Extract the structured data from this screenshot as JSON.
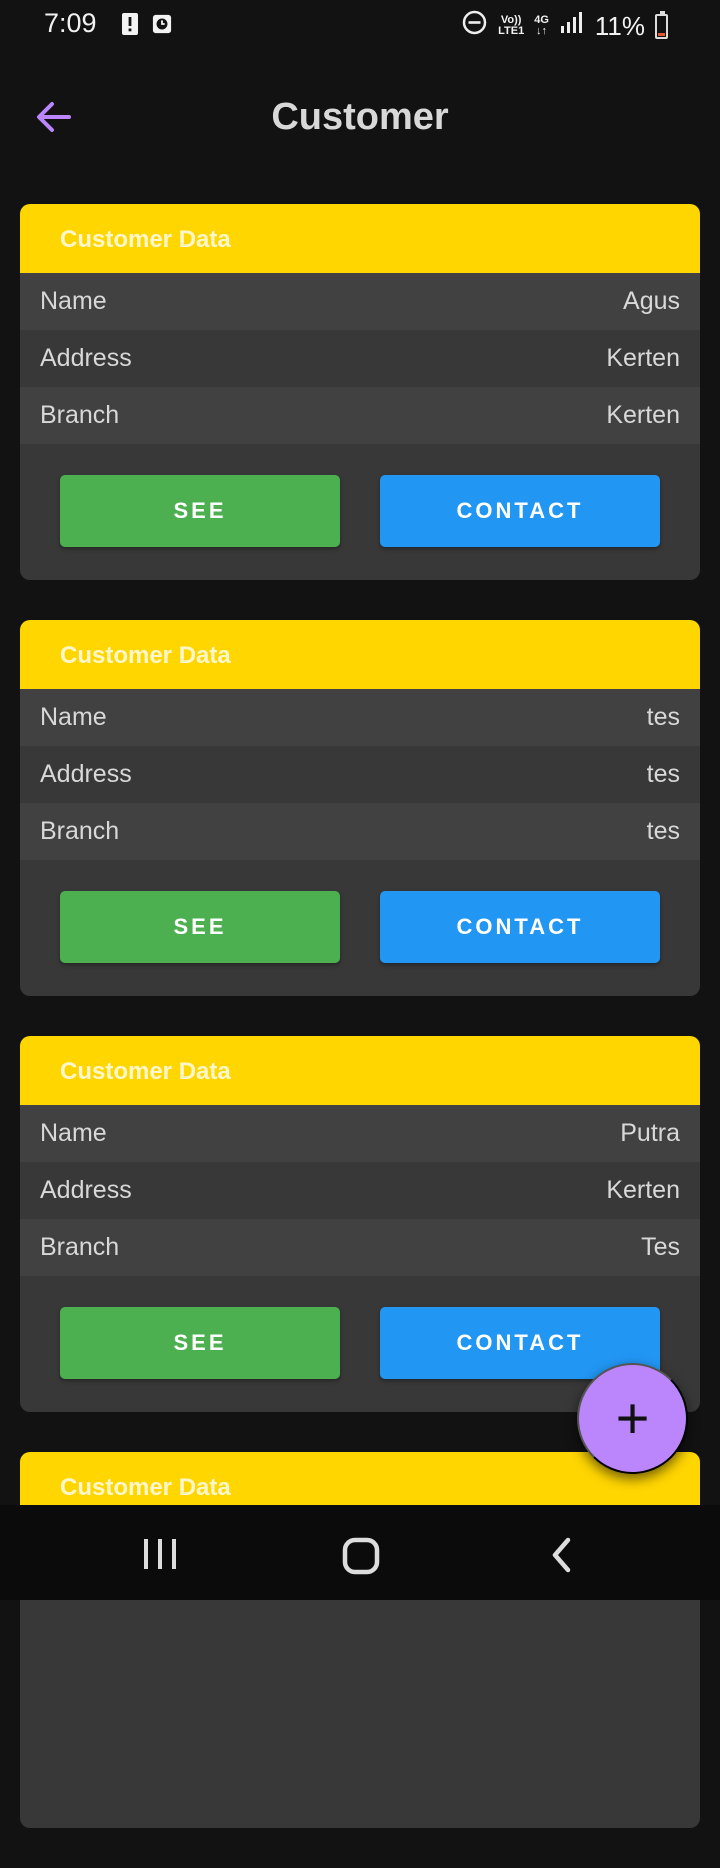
{
  "status": {
    "time": "7:09",
    "network_top": "Vo))",
    "network_bottom": "LTE1",
    "network_type": "4G",
    "battery": "11%"
  },
  "header": {
    "title": "Customer"
  },
  "customers": [
    {
      "header": "Customer Data",
      "name_label": "Name",
      "name": "Agus",
      "address_label": "Address",
      "address": "Kerten",
      "branch_label": "Branch",
      "branch": "Kerten",
      "see": "SEE",
      "contact": "CONTACT"
    },
    {
      "header": "Customer Data",
      "name_label": "Name",
      "name": "tes",
      "address_label": "Address",
      "address": "tes",
      "branch_label": "Branch",
      "branch": "tes",
      "see": "SEE",
      "contact": "CONTACT"
    },
    {
      "header": "Customer Data",
      "name_label": "Name",
      "name": "Putra",
      "address_label": "Address",
      "address": "Kerten",
      "branch_label": "Branch",
      "branch": "Tes",
      "see": "SEE",
      "contact": "CONTACT"
    },
    {
      "header": "Customer Data"
    }
  ],
  "fab": {
    "label": "+"
  },
  "colors": {
    "accent": "#bb86fc",
    "card_header": "#ffd600",
    "see_button": "#4caf50",
    "contact_button": "#2196f3"
  }
}
